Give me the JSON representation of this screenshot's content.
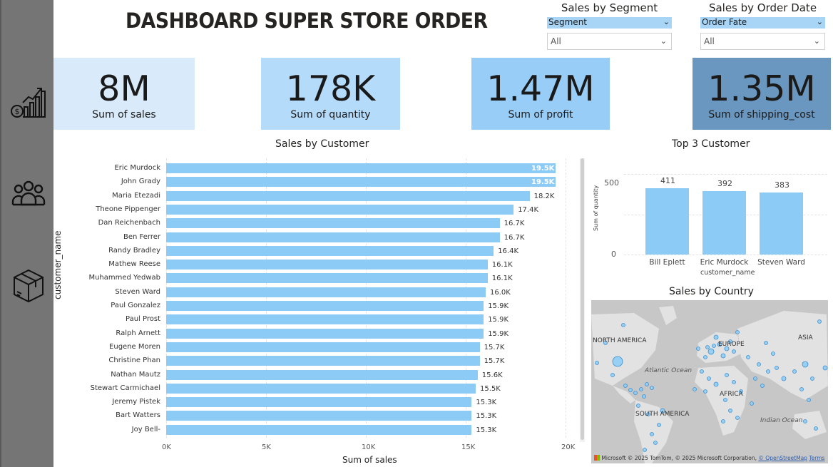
{
  "header": {
    "title": "DASHBOARD SUPER STORE ORDER"
  },
  "nav": {
    "items": [
      {
        "icon": "sales-chart-icon"
      },
      {
        "icon": "customers-icon"
      },
      {
        "icon": "package-box-icon"
      }
    ]
  },
  "slicers": {
    "segment": {
      "title": "Sales by Segment",
      "field": "Segment",
      "value": "All"
    },
    "order_date": {
      "title": "Sales by Order Date",
      "field": "Order Fate",
      "value": "All"
    }
  },
  "kpis": [
    {
      "value": "8M",
      "label": "Sum of sales",
      "color": "#d9ebfb"
    },
    {
      "value": "178K",
      "label": "Sum of quantity",
      "color": "#b5dbfa"
    },
    {
      "value": "1.47M",
      "label": "Sum of profit",
      "color": "#97cdf7"
    },
    {
      "value": "1.35M",
      "label": "Sum of shipping_cost",
      "color": "#6a97c0"
    }
  ],
  "sales_by_customer": {
    "title": "Sales by Customer",
    "ylabel": "customer_name",
    "xlabel": "Sum of sales",
    "ticks": [
      "0K",
      "5K",
      "10K",
      "15K",
      "20K"
    ]
  },
  "top3": {
    "title": "Top 3 Customer",
    "ylabel": "Sum of quantity",
    "xlabel": "customer_name",
    "ticks": [
      "500",
      "0"
    ]
  },
  "map": {
    "title": "Sales by Country",
    "labels": {
      "na": "NORTH AMERICA",
      "sa": "SOUTH AMERICA",
      "eu": "EUROPE",
      "af": "AFRICA",
      "as": "ASIA",
      "atl": "Atlantic Ocean",
      "ind": "Indian Ocean"
    },
    "brand": "Microsoft",
    "attribution": "© 2025 TomTom, © 2025 Microsoft Corporation,",
    "osm": "© OpenStreetMap",
    "terms": "Terms"
  },
  "chart_data": [
    {
      "type": "bar",
      "orientation": "horizontal",
      "title": "Sales by Customer",
      "xlabel": "Sum of sales",
      "ylabel": "customer_name",
      "xlim": [
        0,
        20000
      ],
      "categories": [
        "Eric Murdock",
        "John Grady",
        "Maria Etezadi",
        "Theone Pippenger",
        "Dan Reichenbach",
        "Ben Ferrer",
        "Randy Bradley",
        "Mathew Reese",
        "Muhammed Yedwab",
        "Steven Ward",
        "Paul Gonzalez",
        "Paul Prost",
        "Ralph Arnett",
        "Eugene Moren",
        "Christine Phan",
        "Nathan Mautz",
        "Stewart Carmichael",
        "Jeremy Pistek",
        "Bart Watters",
        "Joy Bell-"
      ],
      "values": [
        19500,
        19500,
        18200,
        17400,
        16700,
        16700,
        16400,
        16100,
        16100,
        16000,
        15900,
        15900,
        15900,
        15700,
        15700,
        15600,
        15500,
        15300,
        15300,
        15300
      ],
      "data_labels": [
        "19.5K",
        "19.5K",
        "18.2K",
        "17.4K",
        "16.7K",
        "16.7K",
        "16.4K",
        "16.1K",
        "16.1K",
        "16.0K",
        "15.9K",
        "15.9K",
        "15.9K",
        "15.7K",
        "15.7K",
        "15.6K",
        "15.5K",
        "15.3K",
        "15.3K",
        "15.3K"
      ]
    },
    {
      "type": "bar",
      "title": "Top 3 Customer",
      "xlabel": "customer_name",
      "ylabel": "Sum of quantity",
      "ylim": [
        0,
        500
      ],
      "categories": [
        "Bill Eplett",
        "Eric Murdock",
        "Steven Ward"
      ],
      "values": [
        411,
        392,
        383
      ]
    }
  ]
}
